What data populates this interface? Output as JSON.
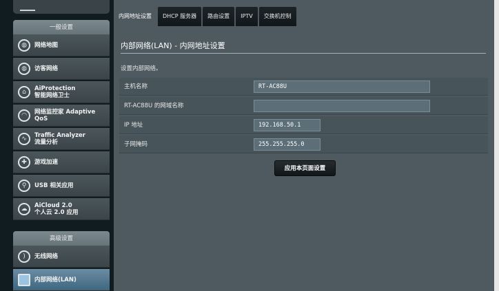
{
  "sidebar": {
    "general_header": "一般设置",
    "general_items": [
      {
        "label_1": "网络地图",
        "label_2": "",
        "icon": "globe-map-icon"
      },
      {
        "label_1": "访客网络",
        "label_2": "",
        "icon": "guest-network-icon"
      },
      {
        "label_1": "AiProtection",
        "label_2": "智能网络卫士",
        "icon": "shield-icon"
      },
      {
        "label_1": "网络监控家 Adaptive",
        "label_2": "QoS",
        "icon": "gauge-icon"
      },
      {
        "label_1": "Traffic Analyzer",
        "label_2": "流量分析",
        "icon": "pulse-icon"
      },
      {
        "label_1": "游戏加速",
        "label_2": "",
        "icon": "gamepad-icon"
      },
      {
        "label_1": "USB 相关应用",
        "label_2": "",
        "icon": "usb-icon"
      },
      {
        "label_1": "AiCloud 2.0",
        "label_2": "个人云 2.0 应用",
        "icon": "cloud-icon"
      }
    ],
    "advanced_header": "高级设置",
    "advanced_items": [
      {
        "label_1": "无线网络",
        "label_2": "",
        "icon": "wifi-icon"
      },
      {
        "label_1": "内部网络(LAN)",
        "label_2": "",
        "icon": "lan-icon"
      }
    ]
  },
  "tabs": [
    "内网地址设置",
    "DHCP 服务器",
    "路由设置",
    "IPTV",
    "交换机控制"
  ],
  "page": {
    "title": "内部网络(LAN) - 内网地址设置",
    "description": "设置内部网络。"
  },
  "form": {
    "hostname_label": "主机名称",
    "hostname_value": "RT-AC88U",
    "domain_label": "RT-AC88U 的网域名称",
    "domain_value": "",
    "ip_label": "IP 地址",
    "ip_value": "192.168.50.1",
    "mask_label": "子网掩码",
    "mask_value": "255.255.255.0"
  },
  "apply_label": "应用本页面设置"
}
